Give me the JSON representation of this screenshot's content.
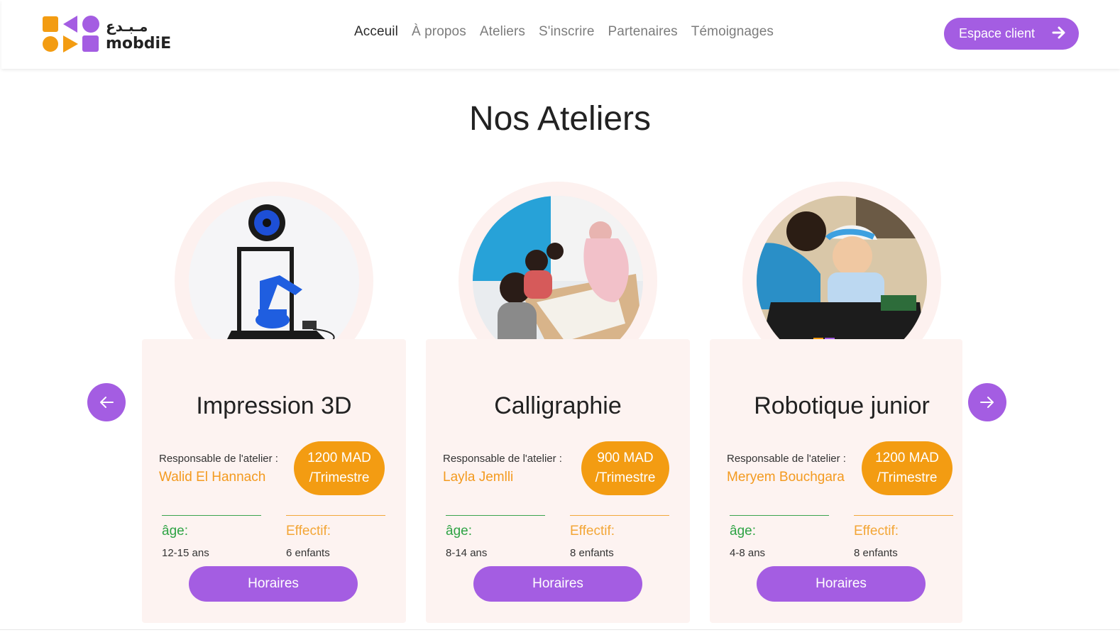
{
  "brand": {
    "arabic": "مـبـدع",
    "latin": "mobdiE",
    "colors": {
      "orange": "#f39c12",
      "purple": "#a45de2"
    }
  },
  "nav": {
    "items": [
      "Acceuil",
      "À propos",
      "Ateliers",
      "S'inscrire",
      "Partenaires",
      "Témoignages"
    ],
    "active": "Acceuil"
  },
  "header": {
    "cta_label": "Espace client",
    "cta_icon": "arrow-right-icon"
  },
  "section": {
    "title": "Nos Ateliers"
  },
  "carousel": {
    "prev_icon": "arrow-left-icon",
    "next_icon": "arrow-right-icon"
  },
  "cards": [
    {
      "title": "Impression 3D",
      "resp_label": "Responsable de l'atelier :",
      "resp_name": "Walid El Hannach",
      "price_line1": "1200 MAD",
      "price_line2": "/Trimestre",
      "age_label": "âge:",
      "age_value": "12-15 ans",
      "eff_label": "Effectif:",
      "eff_value": "6 enfants",
      "button": "Horaires",
      "image": "3d-printer-photo"
    },
    {
      "title": "Calligraphie",
      "resp_label": "Responsable de l'atelier :",
      "resp_name": "Layla Jemlli",
      "price_line1": "900 MAD",
      "price_line2": "/Trimestre",
      "age_label": "âge:",
      "age_value": "8-14 ans",
      "eff_label": "Effectif:",
      "eff_value": "8 enfants",
      "button": "Horaires",
      "image": "calligraphy-class-photo"
    },
    {
      "title": "Robotique junior",
      "resp_label": "Responsable de l'atelier :",
      "resp_name": "Meryem Bouchgara",
      "price_line1": "1200 MAD",
      "price_line2": "/Trimestre",
      "age_label": "âge:",
      "age_value": "4-8 ans",
      "eff_label": "Effectif:",
      "eff_value": "8 enfants",
      "button": "Horaires",
      "image": "robotics-class-photo"
    }
  ]
}
